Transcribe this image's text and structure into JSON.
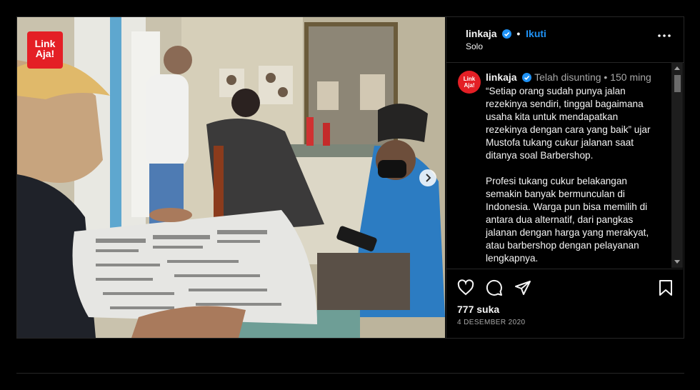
{
  "post": {
    "username": "linkaja",
    "follow_label": "Ikuti",
    "location": "Solo",
    "logo_text_1": "Link",
    "logo_text_2": "Aja!",
    "avatar_text": "LinkAja!"
  },
  "comment": {
    "username": "linkaja",
    "edited_label": "Telah disunting",
    "separator": "•",
    "time": "150 ming",
    "paragraphs": [
      "“Setiap orang sudah punya jalan rezekinya sendiri, tinggal bagaimana usaha kita untuk mendapatkan rezekinya dengan cara yang baik” ujar Mustofa tukang cukur jalanan saat ditanya soal Barbershop.",
      "Profesi tukang cukur belakangan semakin banyak bermunculan di Indonesia. Warga pun bisa memilih di antara dua alternatif, dari pangkas jalanan dengan harga yang merakyat, atau barbershop dengan pelayanan lengkapnya."
    ]
  },
  "stats": {
    "likes": "777 suka",
    "date": "4 DESEMBER 2020"
  },
  "icons": {
    "more": "more-dots-icon",
    "like": "heart-icon",
    "comment": "comment-icon",
    "share": "share-icon",
    "save": "bookmark-icon",
    "next": "chevron-right-icon",
    "verified": "verified-badge-icon"
  },
  "colors": {
    "accent": "#1f92f5",
    "brand": "#e41f25",
    "background": "#000000"
  }
}
